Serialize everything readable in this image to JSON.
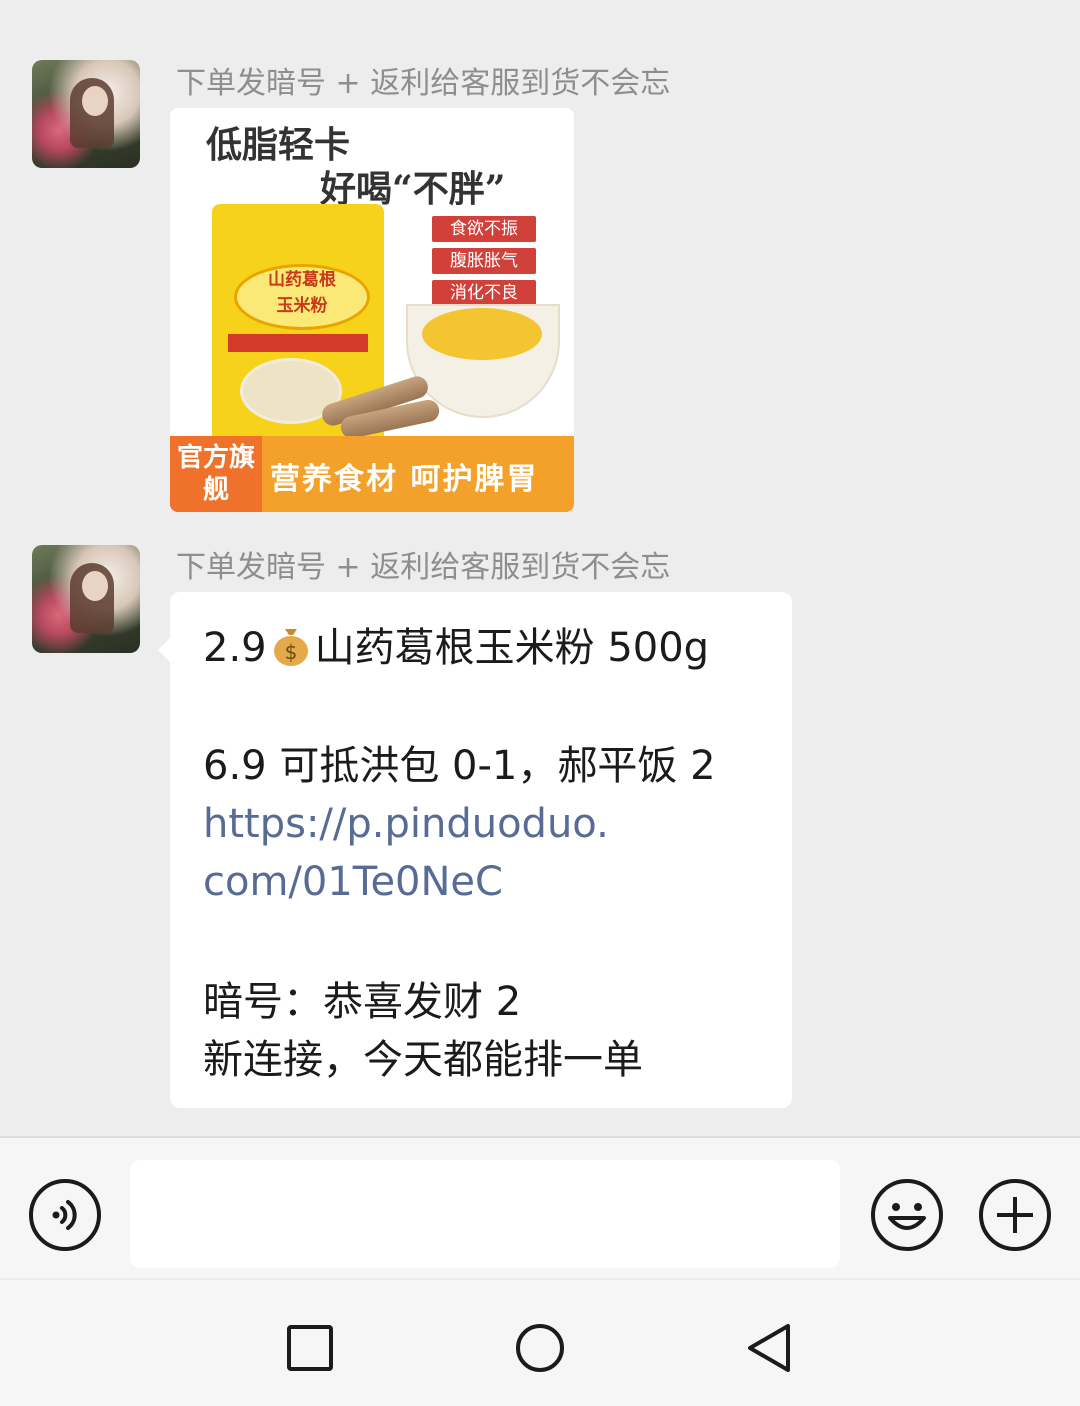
{
  "messages": [
    {
      "sender": "下单发暗号 + 返利给客服到货不会忘",
      "type": "image",
      "image": {
        "title_line1": "低脂轻卡",
        "title_line2": "好喝“不胖”",
        "tags": [
          "食欲不振",
          "腹胀胀气",
          "消化不良"
        ],
        "bag_label": [
          "山药葛根",
          "玉米粉"
        ],
        "badge": "官方旗舰",
        "slogan": "营养食材 呵护脾胃"
      }
    },
    {
      "sender": "下单发暗号 + 返利给客服到货不会忘",
      "type": "text",
      "lines": {
        "price": "2.9",
        "product": "山药葛根玉米粉 500g",
        "deal": "6.9 可抵洪包 0-1，郝平饭 2",
        "link1": "https://p.pinduoduo.",
        "link2": "com/01Te0NeC",
        "code": "暗号：恭喜发财 2",
        "note": "新连接，今天都能排一单"
      }
    }
  ],
  "input_bar": {
    "value": ""
  },
  "icons": [
    "voice-icon",
    "emoji-icon",
    "plus-icon",
    "nav-recents-icon",
    "nav-home-icon",
    "nav-back-icon",
    "money-bag-icon"
  ],
  "colors": {
    "background": "#ededed",
    "link": "#576b95",
    "bubble": "#ffffff"
  }
}
